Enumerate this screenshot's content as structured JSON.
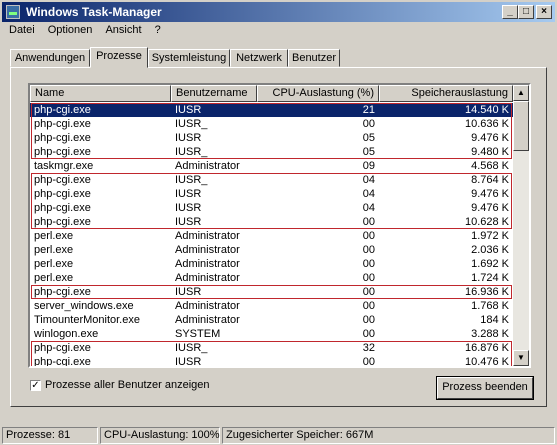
{
  "window": {
    "title": "Windows Task-Manager"
  },
  "titlebar_buttons": [
    "_",
    "□",
    "×"
  ],
  "menu": [
    "Datei",
    "Optionen",
    "Ansicht",
    "?"
  ],
  "tabs": [
    "Anwendungen",
    "Prozesse",
    "Systemleistung",
    "Netzwerk",
    "Benutzer"
  ],
  "active_tab": "Prozesse",
  "columns": [
    "Name",
    "Benutzername",
    "CPU-Auslastung (%)",
    "Speicherauslastung"
  ],
  "rows": [
    {
      "name": "php-cgi.exe",
      "user": "IUSR",
      "cpu": "21",
      "mem": "14.540 K",
      "selected": true
    },
    {
      "name": "php-cgi.exe",
      "user": "IUSR_",
      "cpu": "00",
      "mem": "10.636 K"
    },
    {
      "name": "php-cgi.exe",
      "user": "IUSR",
      "cpu": "05",
      "mem": "9.476 K"
    },
    {
      "name": "php-cgi.exe",
      "user": "IUSR_",
      "cpu": "05",
      "mem": "9.480 K"
    },
    {
      "name": "taskmgr.exe",
      "user": "Administrator",
      "cpu": "09",
      "mem": "4.568 K"
    },
    {
      "name": "php-cgi.exe",
      "user": "IUSR_",
      "cpu": "04",
      "mem": "8.764 K"
    },
    {
      "name": "php-cgi.exe",
      "user": "IUSR",
      "cpu": "04",
      "mem": "9.476 K"
    },
    {
      "name": "php-cgi.exe",
      "user": "IUSR",
      "cpu": "04",
      "mem": "9.476 K"
    },
    {
      "name": "php-cgi.exe",
      "user": "IUSR",
      "cpu": "00",
      "mem": "10.628 K"
    },
    {
      "name": "perl.exe",
      "user": "Administrator",
      "cpu": "00",
      "mem": "1.972 K"
    },
    {
      "name": "perl.exe",
      "user": "Administrator",
      "cpu": "00",
      "mem": "2.036 K"
    },
    {
      "name": "perl.exe",
      "user": "Administrator",
      "cpu": "00",
      "mem": "1.692 K"
    },
    {
      "name": "perl.exe",
      "user": "Administrator",
      "cpu": "00",
      "mem": "1.724 K"
    },
    {
      "name": "php-cgi.exe",
      "user": "IUSR",
      "cpu": "00",
      "mem": "16.936 K"
    },
    {
      "name": "server_windows.exe",
      "user": "Administrator",
      "cpu": "00",
      "mem": "1.768 K"
    },
    {
      "name": "TimounterMonitor.exe",
      "user": "Administrator",
      "cpu": "00",
      "mem": "184 K"
    },
    {
      "name": "winlogon.exe",
      "user": "SYSTEM",
      "cpu": "00",
      "mem": "3.288 K"
    },
    {
      "name": "php-cgi.exe",
      "user": "IUSR_",
      "cpu": "32",
      "mem": "16.876 K"
    },
    {
      "name": "php-cgi.exe",
      "user": "IUSR_",
      "cpu": "00",
      "mem": "10.476 K"
    }
  ],
  "highlight_color": "#c0272d",
  "checkbox": {
    "label": "Prozesse aller Benutzer anzeigen",
    "checked": true
  },
  "end_button": "Prozess beenden",
  "status": {
    "processes": "Prozesse: 81",
    "cpu": "CPU-Auslastung: 100%",
    "commit": "Zugesicherter Speicher: 667M"
  }
}
